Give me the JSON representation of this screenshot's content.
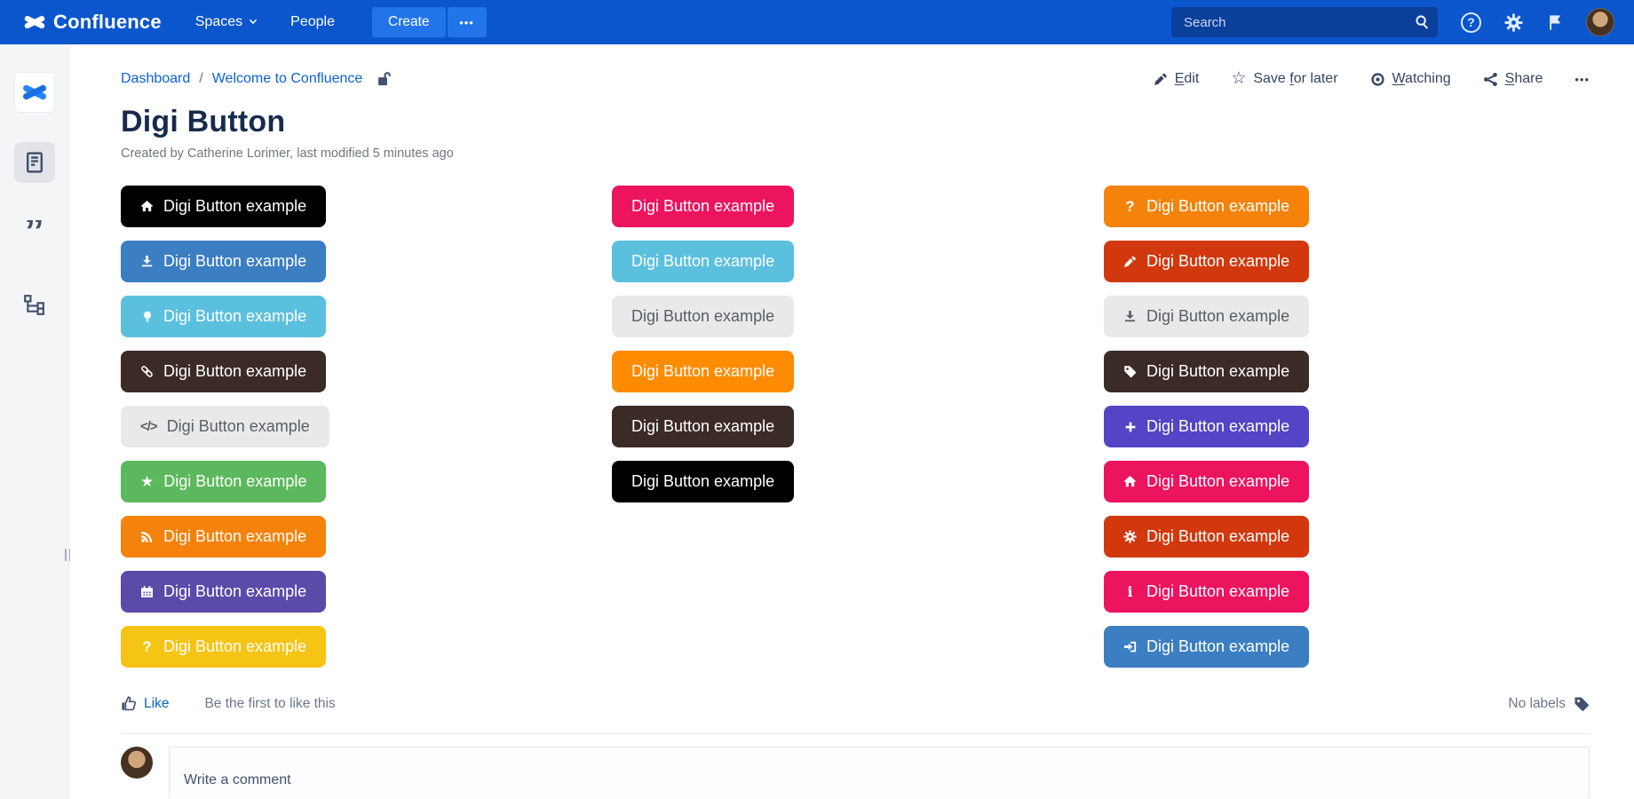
{
  "theme": {
    "navbar_bg": "#0B56CD",
    "navbar_button_bg": "#2175E8",
    "search_bg": "#0A3F9A",
    "link_color": "#0B63CE",
    "text_dark": "#172B4D",
    "text_muted": "#6B778C",
    "sidebar_bg": "#F4F5F7",
    "icon_slate": "#42526E"
  },
  "navbar": {
    "product_name": "Confluence",
    "spaces_label": "Spaces",
    "people_label": "People",
    "create_label": "Create",
    "more_label": "•••",
    "search_placeholder": "Search",
    "icons": [
      "confluence-logo",
      "chevron-down",
      "search",
      "help",
      "gear",
      "notification-flag",
      "user-avatar"
    ]
  },
  "sidebar": {
    "icons": [
      "space-logo",
      "pages",
      "blog-quote",
      "page-tree"
    ]
  },
  "breadcrumb": {
    "dashboard": "Dashboard",
    "separator": "/",
    "space": "Welcome to Confluence",
    "icon": "unlock"
  },
  "actions": {
    "edit": {
      "pre": "",
      "key": "E",
      "post": "dit"
    },
    "save": {
      "pre": "Save ",
      "key": "f",
      "post": "or later"
    },
    "watching": {
      "pre": "",
      "key": "W",
      "post": "atching"
    },
    "share": {
      "pre": "",
      "key": "S",
      "post": "hare"
    },
    "more": "•••"
  },
  "page": {
    "title": "Digi Button",
    "byline": "Created by Catherine Lorimer, last modified 5 minutes ago"
  },
  "buttons": {
    "label": "Digi Button example",
    "columns": [
      [
        {
          "icon": "home",
          "bg": "#000000",
          "fg": "#FFFFFF"
        },
        {
          "icon": "download",
          "bg": "#3B7EC2",
          "fg": "#FFFFFF"
        },
        {
          "icon": "lightbulb",
          "bg": "#5BC0DE",
          "fg": "#FFFFFF"
        },
        {
          "icon": "link",
          "bg": "#3B2B26",
          "fg": "#FFFFFF"
        },
        {
          "icon": "code",
          "bg": "#E9E9E9",
          "fg": "#57606A"
        },
        {
          "icon": "star",
          "bg": "#5CB85C",
          "fg": "#FFFFFF"
        },
        {
          "icon": "rss",
          "bg": "#F5820A",
          "fg": "#FFFFFF"
        },
        {
          "icon": "calendar",
          "bg": "#5B4AA8",
          "fg": "#FFFFFF"
        },
        {
          "icon": "question",
          "bg": "#F5C414",
          "fg": "#FFFFFF"
        }
      ],
      [
        {
          "icon": null,
          "bg": "#EC135F",
          "fg": "#FFFFFF"
        },
        {
          "icon": null,
          "bg": "#5BC0DE",
          "fg": "#FFFFFF"
        },
        {
          "icon": null,
          "bg": "#E9E9E9",
          "fg": "#57606A"
        },
        {
          "icon": null,
          "bg": "#FF8C00",
          "fg": "#FFFFFF"
        },
        {
          "icon": null,
          "bg": "#3B2B26",
          "fg": "#FFFFFF"
        },
        {
          "icon": null,
          "bg": "#000000",
          "fg": "#FFFFFF"
        }
      ],
      [
        {
          "icon": "question",
          "bg": "#F5820A",
          "fg": "#FFFFFF"
        },
        {
          "icon": "pencil",
          "bg": "#D2380D",
          "fg": "#FFFFFF"
        },
        {
          "icon": "download",
          "bg": "#E9E9E9",
          "fg": "#57606A"
        },
        {
          "icon": "tag",
          "bg": "#3B2B26",
          "fg": "#FFFFFF"
        },
        {
          "icon": "plus",
          "bg": "#5345C6",
          "fg": "#FFFFFF"
        },
        {
          "icon": "home",
          "bg": "#EC135F",
          "fg": "#FFFFFF"
        },
        {
          "icon": "gear",
          "bg": "#D2380D",
          "fg": "#FFFFFF"
        },
        {
          "icon": "info",
          "bg": "#EC135F",
          "fg": "#FFFFFF"
        },
        {
          "icon": "signin",
          "bg": "#3B7EC2",
          "fg": "#FFFFFF"
        }
      ]
    ]
  },
  "social": {
    "like_label": "Like",
    "like_hint": "Be the first to like this",
    "labels_text": "No labels"
  },
  "comment": {
    "placeholder": "Write a comment"
  }
}
